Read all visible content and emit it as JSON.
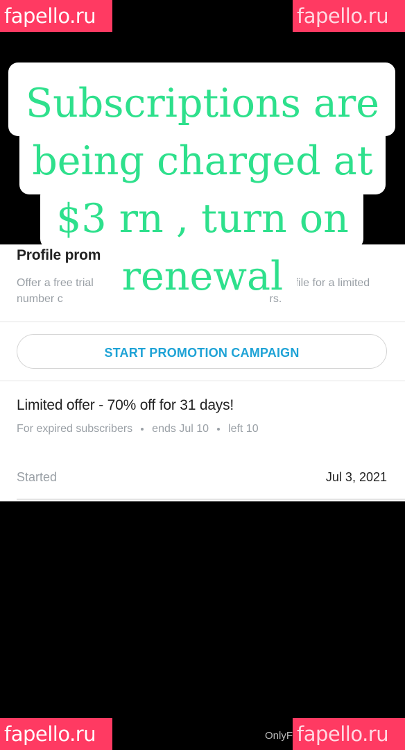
{
  "watermark": {
    "text": "fapello.ru",
    "color": "#ff3a62"
  },
  "caption": {
    "lines": [
      "Subscriptions are",
      "being charged at",
      "$3 rn , turn on",
      "renewal"
    ],
    "text_color": "#2ee08c"
  },
  "profile_promotion": {
    "title": "Profile prom",
    "description": "Offer a free trial                                                        ur profile for a limited number c                                                                   rs."
  },
  "promotion_button": {
    "label": "START PROMOTION CAMPAIGN",
    "color": "#1fa3d6"
  },
  "offer": {
    "title": "Limited offer - 70% off for 31 days!",
    "audience": "For expired subscribers",
    "ends": "ends Jul 10",
    "left": "left 10",
    "started_label": "Started",
    "started_date": "Jul 3, 2021"
  },
  "footer": {
    "text": "OnlyF"
  }
}
